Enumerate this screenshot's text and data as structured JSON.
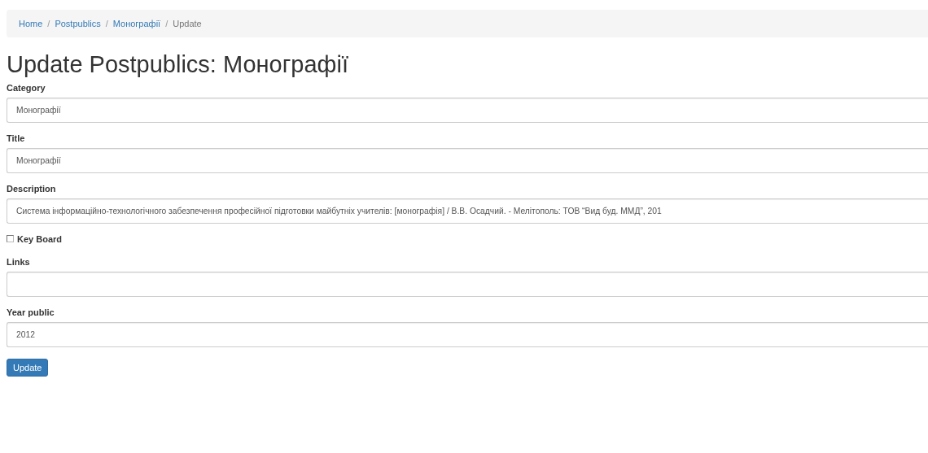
{
  "breadcrumb_separator": "/",
  "breadcrumb": [
    {
      "label": "Home",
      "kind": "link"
    },
    {
      "label": "Postpublics",
      "kind": "link"
    },
    {
      "label": "Монографії",
      "kind": "link"
    },
    {
      "label": "Update",
      "kind": "current"
    }
  ],
  "heading": "Update Postpublics: Монографії",
  "fields": [
    {
      "kind": "text",
      "label": "Category",
      "value": "Монографії"
    },
    {
      "kind": "text",
      "label": "Title",
      "value": "Монографії"
    },
    {
      "kind": "text",
      "label": "Description",
      "value": "Система інформаційно-технологічного забезпечення професійної підготовки майбутніх учителів: [монографія] / В.В. Осадчий. - Мелітополь: ТОВ “Вид буд. ММД”, 201"
    },
    {
      "kind": "checkbox",
      "label": "Key Board",
      "checked": false
    },
    {
      "kind": "text",
      "label": "Links"
    },
    {
      "kind": "text",
      "label": "Year public",
      "value": "2012"
    }
  ],
  "button": "Update"
}
